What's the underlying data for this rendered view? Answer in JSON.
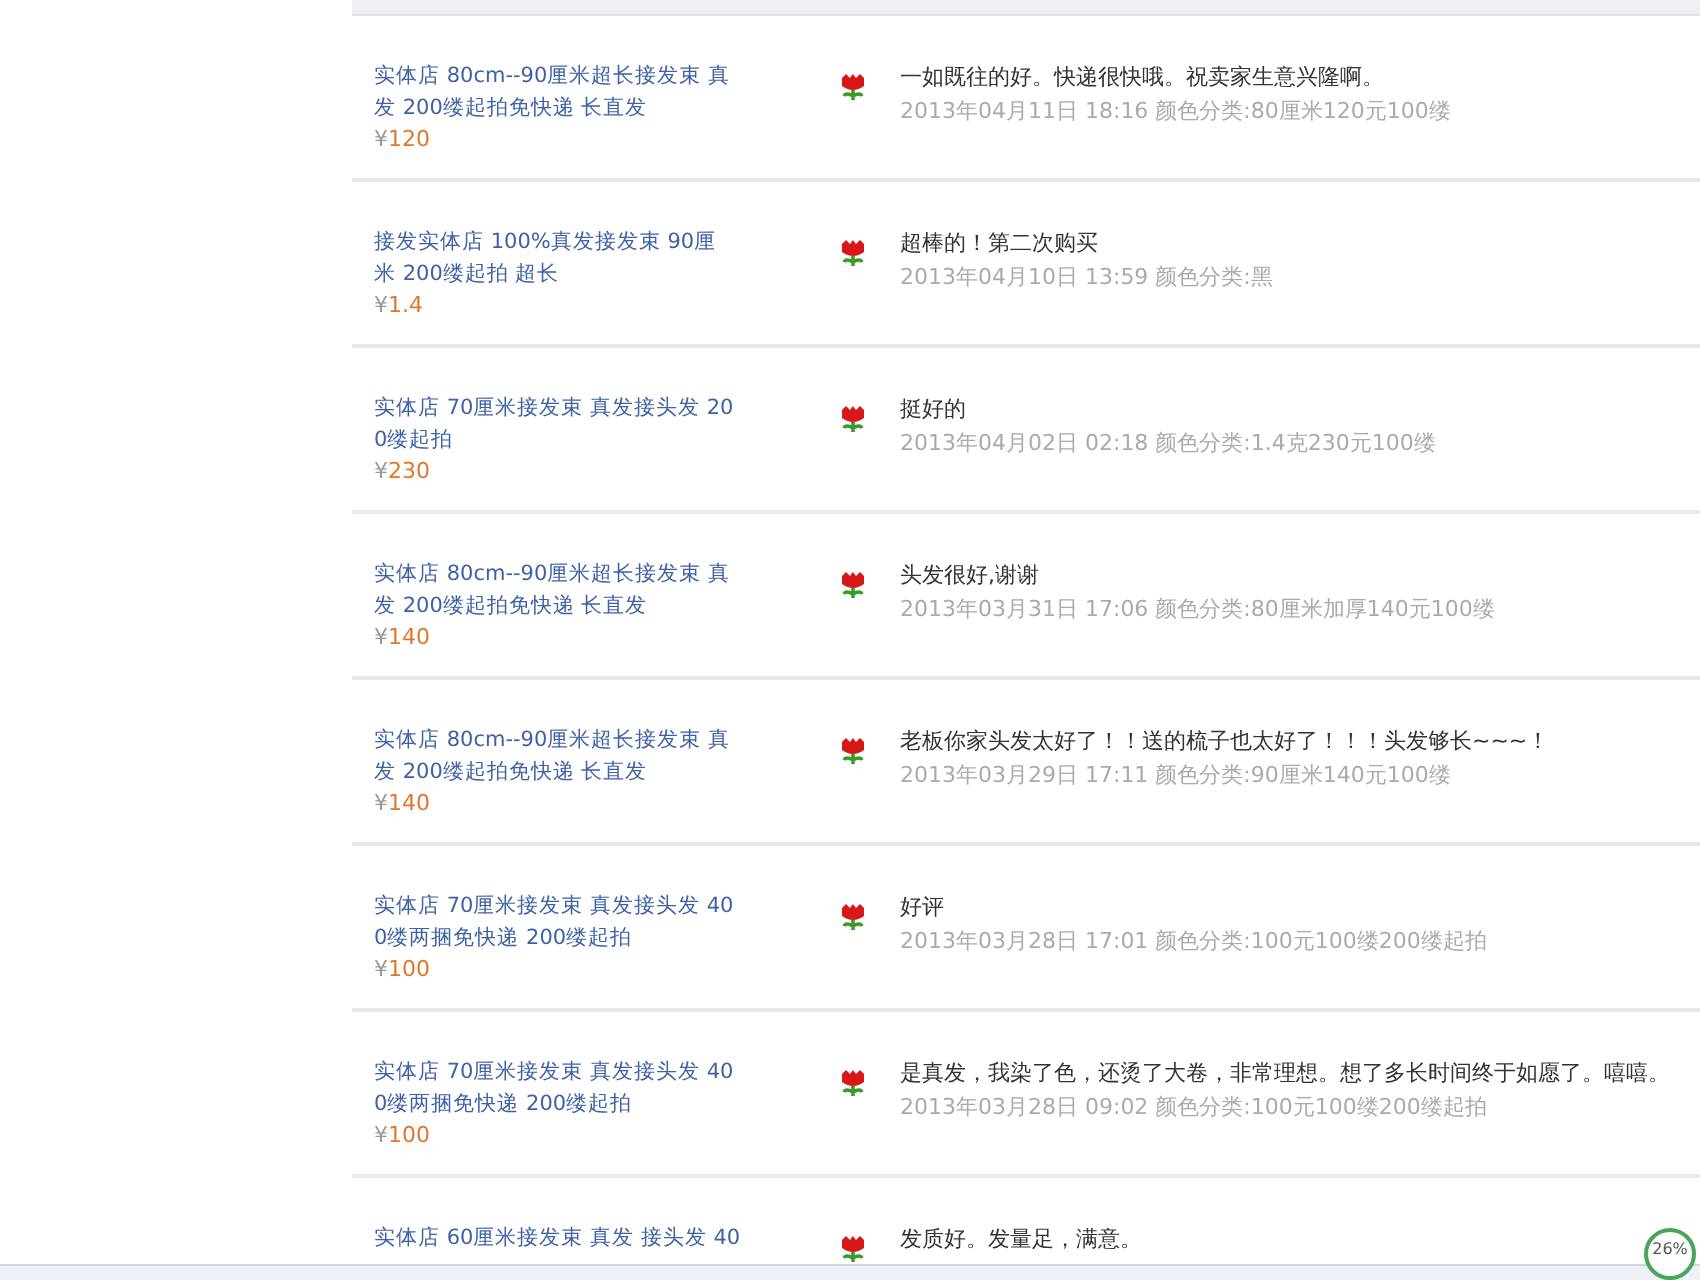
{
  "reviews": [
    {
      "title": "实体店 80cm--90厘米超长接发束 真发 200缕起拍免快递 长直发",
      "currency": "¥",
      "price": "120",
      "comment": "一如既往的好。快递很快哦。祝卖家生意兴隆啊。",
      "meta": "2013年04月11日 18:16 颜色分类:80厘米120元100缕"
    },
    {
      "title": "接发实体店 100%真发接发束 90厘米 200缕起拍 超长",
      "currency": "¥",
      "price": "1.4",
      "comment": "超棒的！第二次购买",
      "meta": "2013年04月10日 13:59 颜色分类:黑"
    },
    {
      "title": "实体店 70厘米接发束 真发接头发 200缕起拍",
      "currency": "¥",
      "price": "230",
      "comment": "挺好的",
      "meta": "2013年04月02日 02:18 颜色分类:1.4克230元100缕"
    },
    {
      "title": "实体店 80cm--90厘米超长接发束 真发 200缕起拍免快递 长直发",
      "currency": "¥",
      "price": "140",
      "comment": "头发很好,谢谢",
      "meta": "2013年03月31日 17:06 颜色分类:80厘米加厚140元100缕"
    },
    {
      "title": "实体店 80cm--90厘米超长接发束 真发 200缕起拍免快递 长直发",
      "currency": "¥",
      "price": "140",
      "comment": "老板你家头发太好了！！送的梳子也太好了！！！头发够长~~~！",
      "meta": "2013年03月29日 17:11 颜色分类:90厘米140元100缕"
    },
    {
      "title": "实体店 70厘米接发束 真发接头发 400缕两捆免快递 200缕起拍",
      "currency": "¥",
      "price": "100",
      "comment": "好评",
      "meta": "2013年03月28日 17:01 颜色分类:100元100缕200缕起拍"
    },
    {
      "title": "实体店 70厘米接发束 真发接头发 400缕两捆免快递 200缕起拍",
      "currency": "¥",
      "price": "100",
      "comment": "是真发，我染了色，还烫了大卷，非常理想。想了多长时间终于如愿了。嘻嘻。",
      "meta": "2013年03月28日 09:02 颜色分类:100元100缕200缕起拍"
    },
    {
      "title": "实体店 60厘米接发束 真发 接头发 40",
      "comment": "发质好。发量足，满意。"
    }
  ],
  "status_bar": {
    "progress": "26%"
  }
}
